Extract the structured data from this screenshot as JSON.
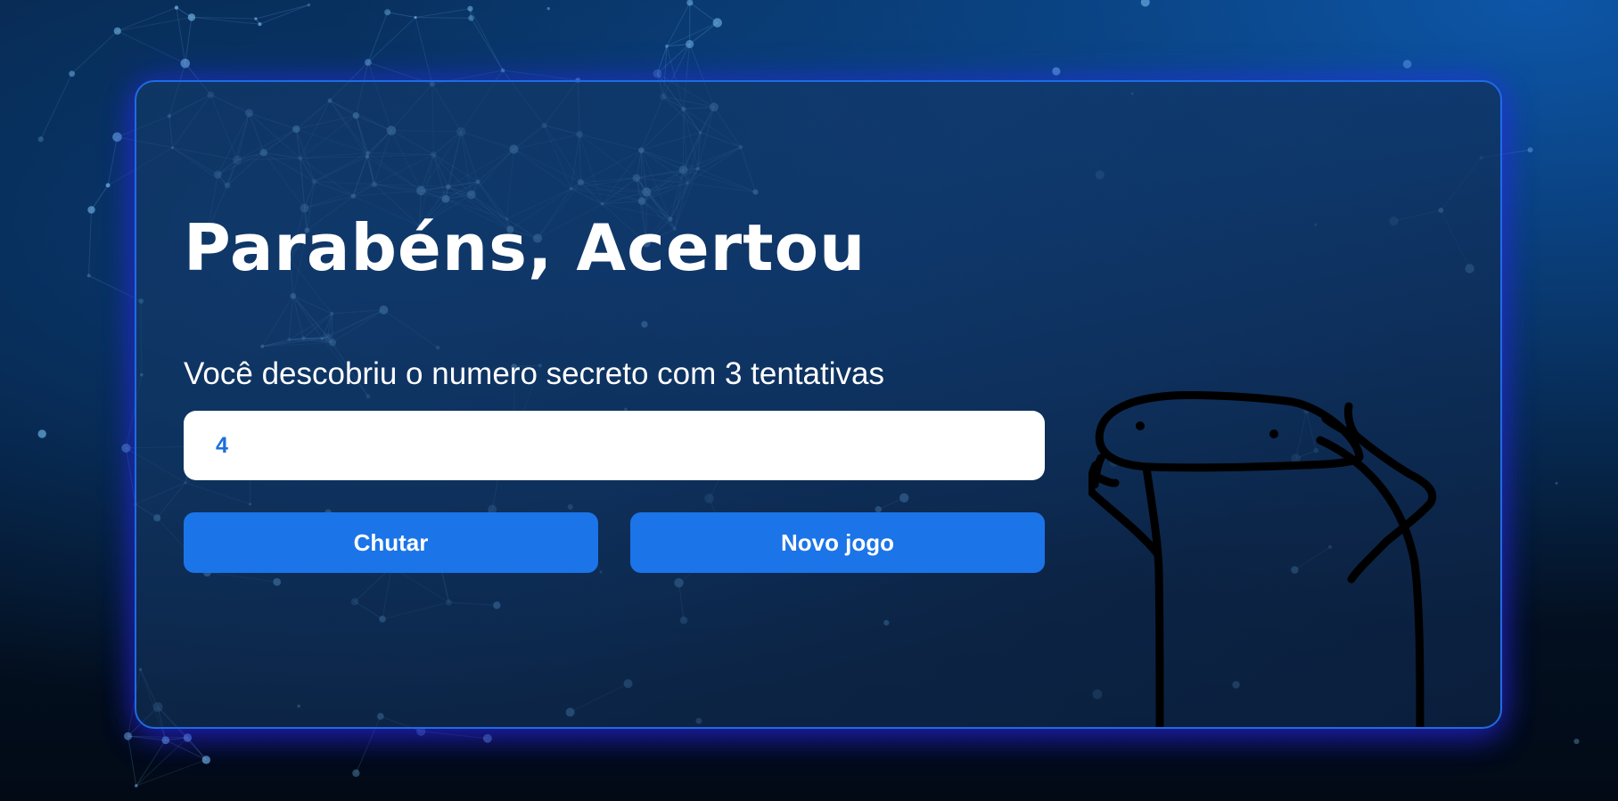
{
  "game": {
    "title": "Parabéns, Acertou",
    "message": "Você descobriu o numero secreto com 3 tentativas",
    "guess_value": "4",
    "guess_button_label": "Chutar",
    "new_game_button_label": "Novo jogo"
  },
  "theme": {
    "accent": "#1b74e8",
    "card_border": "#1f6be6",
    "glow": "#2c30ff",
    "input_text": "#1b6fdd"
  },
  "illustration": {
    "icon": "flork-meme-character"
  }
}
